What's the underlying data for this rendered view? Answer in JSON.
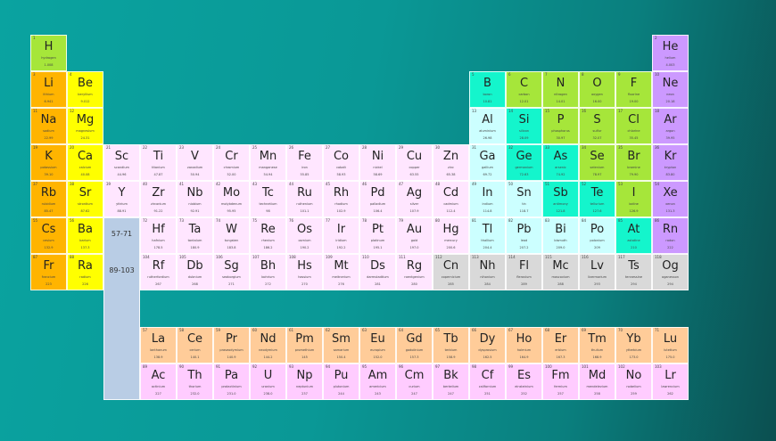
{
  "colors": {
    "alkali": "#ffb400",
    "alkaline": "#ffff00",
    "nonmetal": "#a6e63a",
    "noble": "#cc99ff",
    "transition": "#ffe6ff",
    "post": "#ccffff",
    "metalloid": "#14f5cc",
    "unknown": "#d9d9d9",
    "lanthanide": "#ffcc99",
    "actinide": "#ffccff"
  },
  "placeholders": {
    "lanthanides": "57-71",
    "actinides": "89-103"
  },
  "elements": [
    [
      1,
      "H",
      "hydrogen",
      "1.008",
      "nonmetal",
      1,
      1
    ],
    [
      2,
      "He",
      "helium",
      "4.003",
      "noble",
      18,
      1
    ],
    [
      3,
      "Li",
      "lithium",
      "6.941",
      "alkali",
      1,
      2
    ],
    [
      4,
      "Be",
      "beryllium",
      "9.012",
      "alkaline",
      2,
      2
    ],
    [
      5,
      "B",
      "boron",
      "10.81",
      "metalloid",
      13,
      2
    ],
    [
      6,
      "C",
      "carbon",
      "12.01",
      "nonmetal",
      14,
      2
    ],
    [
      7,
      "N",
      "nitrogen",
      "14.01",
      "nonmetal",
      15,
      2
    ],
    [
      8,
      "O",
      "oxygen",
      "16.00",
      "nonmetal",
      16,
      2
    ],
    [
      9,
      "F",
      "fluorine",
      "19.00",
      "nonmetal",
      17,
      2
    ],
    [
      10,
      "Ne",
      "neon",
      "20.18",
      "noble",
      18,
      2
    ],
    [
      11,
      "Na",
      "sodium",
      "22.99",
      "alkali",
      1,
      3
    ],
    [
      12,
      "Mg",
      "magnesium",
      "24.31",
      "alkaline",
      2,
      3
    ],
    [
      13,
      "Al",
      "aluminium",
      "26.98",
      "post",
      13,
      3
    ],
    [
      14,
      "Si",
      "silicon",
      "28.09",
      "metalloid",
      14,
      3
    ],
    [
      15,
      "P",
      "phosphorus",
      "30.97",
      "nonmetal",
      15,
      3
    ],
    [
      16,
      "S",
      "sulfur",
      "32.07",
      "nonmetal",
      16,
      3
    ],
    [
      17,
      "Cl",
      "chlorine",
      "35.45",
      "nonmetal",
      17,
      3
    ],
    [
      18,
      "Ar",
      "argon",
      "39.95",
      "noble",
      18,
      3
    ],
    [
      19,
      "K",
      "potassium",
      "39.10",
      "alkali",
      1,
      4
    ],
    [
      20,
      "Ca",
      "calcium",
      "40.08",
      "alkaline",
      2,
      4
    ],
    [
      21,
      "Sc",
      "scandium",
      "44.96",
      "transition",
      3,
      4
    ],
    [
      22,
      "Ti",
      "titanium",
      "47.87",
      "transition",
      4,
      4
    ],
    [
      23,
      "V",
      "vanadium",
      "50.94",
      "transition",
      5,
      4
    ],
    [
      24,
      "Cr",
      "chromium",
      "52.00",
      "transition",
      6,
      4
    ],
    [
      25,
      "Mn",
      "manganese",
      "54.94",
      "transition",
      7,
      4
    ],
    [
      26,
      "Fe",
      "iron",
      "55.85",
      "transition",
      8,
      4
    ],
    [
      27,
      "Co",
      "cobalt",
      "58.93",
      "transition",
      9,
      4
    ],
    [
      28,
      "Ni",
      "nickel",
      "58.69",
      "transition",
      10,
      4
    ],
    [
      29,
      "Cu",
      "copper",
      "63.55",
      "transition",
      11,
      4
    ],
    [
      30,
      "Zn",
      "zinc",
      "65.38",
      "transition",
      12,
      4
    ],
    [
      31,
      "Ga",
      "gallium",
      "69.72",
      "post",
      13,
      4
    ],
    [
      32,
      "Ge",
      "germanium",
      "72.63",
      "metalloid",
      14,
      4
    ],
    [
      33,
      "As",
      "arsenic",
      "74.92",
      "metalloid",
      15,
      4
    ],
    [
      34,
      "Se",
      "selenium",
      "78.97",
      "nonmetal",
      16,
      4
    ],
    [
      35,
      "Br",
      "bromine",
      "79.90",
      "nonmetal",
      17,
      4
    ],
    [
      36,
      "Kr",
      "krypton",
      "83.80",
      "noble",
      18,
      4
    ],
    [
      37,
      "Rb",
      "rubidium",
      "85.47",
      "alkali",
      1,
      5
    ],
    [
      38,
      "Sr",
      "strontium",
      "87.62",
      "alkaline",
      2,
      5
    ],
    [
      39,
      "Y",
      "yttrium",
      "88.91",
      "transition",
      3,
      5
    ],
    [
      40,
      "Zr",
      "zirconium",
      "91.22",
      "transition",
      4,
      5
    ],
    [
      41,
      "Nb",
      "niobium",
      "92.91",
      "transition",
      5,
      5
    ],
    [
      42,
      "Mo",
      "molybdenum",
      "95.95",
      "transition",
      6,
      5
    ],
    [
      43,
      "Tc",
      "technetium",
      "98",
      "transition",
      7,
      5
    ],
    [
      44,
      "Ru",
      "ruthenium",
      "101.1",
      "transition",
      8,
      5
    ],
    [
      45,
      "Rh",
      "rhodium",
      "102.9",
      "transition",
      9,
      5
    ],
    [
      46,
      "Pd",
      "palladium",
      "106.4",
      "transition",
      10,
      5
    ],
    [
      47,
      "Ag",
      "silver",
      "107.9",
      "transition",
      11,
      5
    ],
    [
      48,
      "Cd",
      "cadmium",
      "112.4",
      "transition",
      12,
      5
    ],
    [
      49,
      "In",
      "indium",
      "114.8",
      "post",
      13,
      5
    ],
    [
      50,
      "Sn",
      "tin",
      "118.7",
      "post",
      14,
      5
    ],
    [
      51,
      "Sb",
      "antimony",
      "121.8",
      "metalloid",
      15,
      5
    ],
    [
      52,
      "Te",
      "tellurium",
      "127.6",
      "metalloid",
      16,
      5
    ],
    [
      53,
      "I",
      "iodine",
      "126.9",
      "nonmetal",
      17,
      5
    ],
    [
      54,
      "Xe",
      "xenon",
      "131.3",
      "noble",
      18,
      5
    ],
    [
      55,
      "Cs",
      "cesium",
      "132.9",
      "alkali",
      1,
      6
    ],
    [
      56,
      "Ba",
      "barium",
      "137.3",
      "alkaline",
      2,
      6
    ],
    [
      72,
      "Hf",
      "hafnium",
      "178.5",
      "transition",
      4,
      6
    ],
    [
      73,
      "Ta",
      "tantalum",
      "180.9",
      "transition",
      5,
      6
    ],
    [
      74,
      "W",
      "tungsten",
      "183.8",
      "transition",
      6,
      6
    ],
    [
      75,
      "Re",
      "rhenium",
      "186.2",
      "transition",
      7,
      6
    ],
    [
      76,
      "Os",
      "osmium",
      "190.2",
      "transition",
      8,
      6
    ],
    [
      77,
      "Ir",
      "iridium",
      "192.2",
      "transition",
      9,
      6
    ],
    [
      78,
      "Pt",
      "platinum",
      "195.1",
      "transition",
      10,
      6
    ],
    [
      79,
      "Au",
      "gold",
      "197.0",
      "transition",
      11,
      6
    ],
    [
      80,
      "Hg",
      "mercury",
      "200.6",
      "transition",
      12,
      6
    ],
    [
      81,
      "Tl",
      "thallium",
      "204.4",
      "post",
      13,
      6
    ],
    [
      82,
      "Pb",
      "lead",
      "207.2",
      "post",
      14,
      6
    ],
    [
      83,
      "Bi",
      "bismuth",
      "209.0",
      "post",
      15,
      6
    ],
    [
      84,
      "Po",
      "polonium",
      "209",
      "post",
      16,
      6
    ],
    [
      85,
      "At",
      "astatine",
      "210",
      "metalloid",
      17,
      6
    ],
    [
      86,
      "Rn",
      "radon",
      "222",
      "noble",
      18,
      6
    ],
    [
      87,
      "Fr",
      "francium",
      "223",
      "alkali",
      1,
      7
    ],
    [
      88,
      "Ra",
      "radium",
      "226",
      "alkaline",
      2,
      7
    ],
    [
      104,
      "Rf",
      "rutherfordium",
      "267",
      "transition",
      4,
      7
    ],
    [
      105,
      "Db",
      "dubnium",
      "268",
      "transition",
      5,
      7
    ],
    [
      106,
      "Sg",
      "seaborgium",
      "271",
      "transition",
      6,
      7
    ],
    [
      107,
      "Bh",
      "bohrium",
      "272",
      "transition",
      7,
      7
    ],
    [
      108,
      "Hs",
      "hassium",
      "270",
      "transition",
      8,
      7
    ],
    [
      109,
      "Mt",
      "meitnerium",
      "276",
      "transition",
      9,
      7
    ],
    [
      110,
      "Ds",
      "darmstadtium",
      "281",
      "transition",
      10,
      7
    ],
    [
      111,
      "Rg",
      "roentgenium",
      "280",
      "transition",
      11,
      7
    ],
    [
      112,
      "Cn",
      "copernicium",
      "285",
      "unknown",
      12,
      7
    ],
    [
      113,
      "Nh",
      "nihonium",
      "284",
      "unknown",
      13,
      7
    ],
    [
      114,
      "Fl",
      "flerovium",
      "289",
      "unknown",
      14,
      7
    ],
    [
      115,
      "Mc",
      "moscovium",
      "288",
      "unknown",
      15,
      7
    ],
    [
      116,
      "Lv",
      "livermorium",
      "293",
      "unknown",
      16,
      7
    ],
    [
      117,
      "Ts",
      "tennessine",
      "294",
      "unknown",
      17,
      7
    ],
    [
      118,
      "Og",
      "oganesson",
      "294",
      "unknown",
      18,
      7
    ],
    [
      57,
      "La",
      "lanthanum",
      "138.9",
      "lanthanide",
      0,
      8
    ],
    [
      58,
      "Ce",
      "cerium",
      "140.1",
      "lanthanide",
      0,
      8
    ],
    [
      59,
      "Pr",
      "praseodymium",
      "140.9",
      "lanthanide",
      0,
      8
    ],
    [
      60,
      "Nd",
      "neodymium",
      "144.2",
      "lanthanide",
      0,
      8
    ],
    [
      61,
      "Pm",
      "promethium",
      "145",
      "lanthanide",
      0,
      8
    ],
    [
      62,
      "Sm",
      "samarium",
      "150.4",
      "lanthanide",
      0,
      8
    ],
    [
      63,
      "Eu",
      "europium",
      "152.0",
      "lanthanide",
      0,
      8
    ],
    [
      64,
      "Gd",
      "gadolinium",
      "157.3",
      "lanthanide",
      0,
      8
    ],
    [
      65,
      "Tb",
      "terbium",
      "158.9",
      "lanthanide",
      0,
      8
    ],
    [
      66,
      "Dy",
      "dysprosium",
      "162.5",
      "lanthanide",
      0,
      8
    ],
    [
      67,
      "Ho",
      "holmium",
      "164.9",
      "lanthanide",
      0,
      8
    ],
    [
      68,
      "Er",
      "erbium",
      "167.3",
      "lanthanide",
      0,
      8
    ],
    [
      69,
      "Tm",
      "thulium",
      "168.9",
      "lanthanide",
      0,
      8
    ],
    [
      70,
      "Yb",
      "ytterbium",
      "173.0",
      "lanthanide",
      0,
      8
    ],
    [
      71,
      "Lu",
      "lutetium",
      "175.0",
      "lanthanide",
      0,
      8
    ],
    [
      89,
      "Ac",
      "actinium",
      "227",
      "actinide",
      0,
      9
    ],
    [
      90,
      "Th",
      "thorium",
      "232.0",
      "actinide",
      0,
      9
    ],
    [
      91,
      "Pa",
      "protactinium",
      "231.0",
      "actinide",
      0,
      9
    ],
    [
      92,
      "U",
      "uranium",
      "238.0",
      "actinide",
      0,
      9
    ],
    [
      93,
      "Np",
      "neptunium",
      "237",
      "actinide",
      0,
      9
    ],
    [
      94,
      "Pu",
      "plutonium",
      "244",
      "actinide",
      0,
      9
    ],
    [
      95,
      "Am",
      "americium",
      "243",
      "actinide",
      0,
      9
    ],
    [
      96,
      "Cm",
      "curium",
      "247",
      "actinide",
      0,
      9
    ],
    [
      97,
      "Bk",
      "berkelium",
      "247",
      "actinide",
      0,
      9
    ],
    [
      98,
      "Cf",
      "californium",
      "251",
      "actinide",
      0,
      9
    ],
    [
      99,
      "Es",
      "einsteinium",
      "252",
      "actinide",
      0,
      9
    ],
    [
      100,
      "Fm",
      "fermium",
      "257",
      "actinide",
      0,
      9
    ],
    [
      101,
      "Md",
      "mendelevium",
      "258",
      "actinide",
      0,
      9
    ],
    [
      102,
      "No",
      "nobelium",
      "259",
      "actinide",
      0,
      9
    ],
    [
      103,
      "Lr",
      "lawrencium",
      "262",
      "actinide",
      0,
      9
    ]
  ]
}
